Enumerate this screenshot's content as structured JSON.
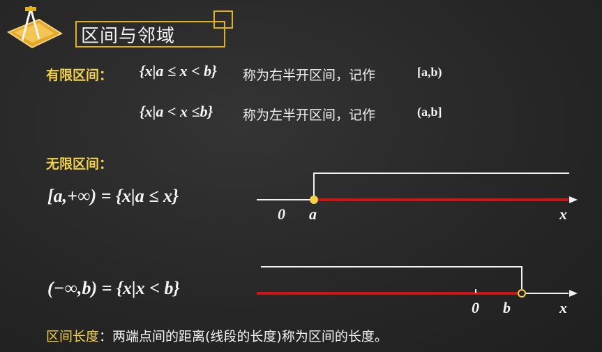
{
  "title": "区间与邻域",
  "finite": {
    "label": "有限区间：",
    "row1": {
      "set": "{x|a ≤ x < b}",
      "desc": "称为右半开区间，记作",
      "notation": "[a,b)"
    },
    "row2": {
      "set": "{x|a < x ≤b}",
      "desc": "称为左半开区间，记作",
      "notation": "(a,b]"
    }
  },
  "infinite": {
    "label": "无限区间：",
    "eq1": "[a,+∞) = {x|a ≤ x}",
    "eq2": "(−∞,b) = {x|x < b}",
    "line1": {
      "zero": "0",
      "point": "a",
      "axis": "x"
    },
    "line2": {
      "zero": "0",
      "point": "b",
      "axis": "x"
    }
  },
  "length": {
    "label": "区间长度",
    "text": "：两端点间的距离(线段的长度)称为区间的长度。"
  },
  "colors": {
    "accent": "#e0b21d",
    "label_yellow": "#f1d24a",
    "ray": "#d01414",
    "background": "#272727"
  },
  "icons": [
    "compass-ruler-logo-icon"
  ]
}
